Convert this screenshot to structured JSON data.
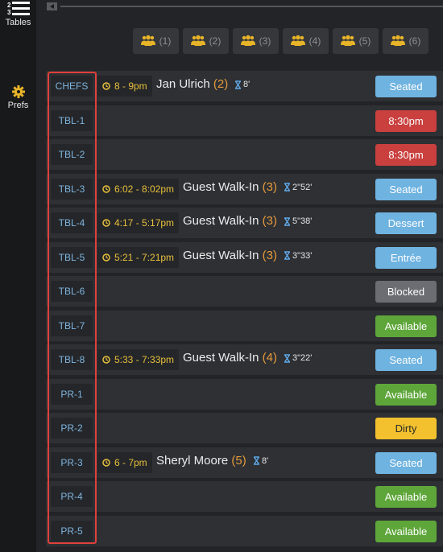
{
  "sidebar": {
    "tables": {
      "label": "Tables",
      "icon": "list-numbered-icon"
    },
    "prefs": {
      "label": "Prefs",
      "icon": "gear-icon"
    }
  },
  "party_filters": [
    {
      "label": "(1)",
      "icon": "group-icon"
    },
    {
      "label": "(2)",
      "icon": "group-icon"
    },
    {
      "label": "(3)",
      "icon": "group-icon"
    },
    {
      "label": "(4)",
      "icon": "group-icon"
    },
    {
      "label": "(5)",
      "icon": "group-icon"
    },
    {
      "label": "(6)",
      "icon": "group-icon"
    }
  ],
  "rows": [
    {
      "table": "CHEFS",
      "time": "8 - 9pm",
      "guest": "Jan Ulrich",
      "party": "(2)",
      "wait": "8'",
      "status": "Seated"
    },
    {
      "table": "TBL-1",
      "status": "8:30pm"
    },
    {
      "table": "TBL-2",
      "status": "8:30pm"
    },
    {
      "table": "TBL-3",
      "time": "6:02 - 8:02pm",
      "guest": "Guest Walk-In",
      "party": "(3)",
      "wait": "2\"52'",
      "status": "Seated"
    },
    {
      "table": "TBL-4",
      "time": "4:17 - 5:17pm",
      "guest": "Guest Walk-In",
      "party": "(3)",
      "wait": "5\"38'",
      "status": "Dessert"
    },
    {
      "table": "TBL-5",
      "time": "5:21 - 7:21pm",
      "guest": "Guest Walk-In",
      "party": "(3)",
      "wait": "3\"33'",
      "status": "Entrée"
    },
    {
      "table": "TBL-6",
      "status": "Blocked"
    },
    {
      "table": "TBL-7",
      "status": "Available"
    },
    {
      "table": "TBL-8",
      "time": "5:33 - 7:33pm",
      "guest": "Guest Walk-In",
      "party": "(4)",
      "wait": "3\"22'",
      "status": "Seated"
    },
    {
      "table": "PR-1",
      "status": "Available"
    },
    {
      "table": "PR-2",
      "status": "Dirty"
    },
    {
      "table": "PR-3",
      "time": "6 - 7pm",
      "guest": "Sheryl Moore",
      "party": "(5)",
      "wait": "8'",
      "status": "Seated"
    },
    {
      "table": "PR-4",
      "status": "Available"
    },
    {
      "table": "PR-5",
      "status": "Available"
    }
  ],
  "colors": {
    "seated": "#6fb3e0",
    "reserved_time": "#c9403e",
    "blocked": "#6b6d72",
    "available": "#5ea63a",
    "dirty": "#f2c12d",
    "highlight": "#e0403a"
  }
}
